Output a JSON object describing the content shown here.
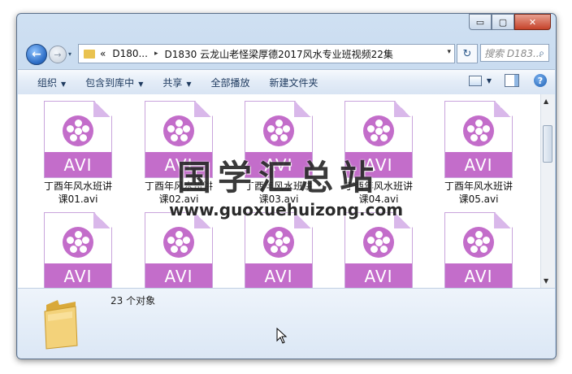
{
  "window": {
    "caption_buttons": {
      "minimize": "▭",
      "maximize": "▢",
      "close": "✕"
    }
  },
  "nav": {
    "history_chevron": "▾",
    "breadcrumb": [
      "«",
      "D180...",
      "D1830 云龙山老怪梁厚德2017风水专业班视频22集"
    ],
    "breadcrumb_separator": "▸",
    "address_dropdown": "▾",
    "refresh_glyph": "↻",
    "search_placeholder": "搜索 D183...",
    "search_glyph": "⌕"
  },
  "toolbar": {
    "organize": "组织",
    "include_library": "包含到库中",
    "share": "共享",
    "play_all": "全部播放",
    "new_folder": "新建文件夹",
    "dropdown_glyph": "▼",
    "help": "?"
  },
  "files": [
    {
      "badge": "AVI",
      "name_line1": "丁酉年风水班讲",
      "name_line2": "课01.avi"
    },
    {
      "badge": "AVI",
      "name_line1": "丁酉年风水班讲",
      "name_line2": "课02.avi"
    },
    {
      "badge": "AVI",
      "name_line1": "丁酉年风水班讲",
      "name_line2": "课03.avi"
    },
    {
      "badge": "AVI",
      "name_line1": "丁酉年风水班讲",
      "name_line2": "课04.avi"
    },
    {
      "badge": "AVI",
      "name_line1": "丁酉年风水班讲",
      "name_line2": "课05.avi"
    },
    {
      "badge": "AVI"
    },
    {
      "badge": "AVI"
    },
    {
      "badge": "AVI"
    },
    {
      "badge": "AVI"
    },
    {
      "badge": "AVI"
    }
  ],
  "details": {
    "count_text": "23 个对象"
  },
  "watermark": {
    "title": "国学汇总站",
    "url": "www.guoxuehuizong.com"
  },
  "colors": {
    "avi_purple": "#c36dca",
    "frame_blue": "#b9d0ea"
  },
  "icons": [
    "back-arrow-icon",
    "forward-arrow-icon",
    "folder-icon",
    "refresh-icon",
    "search-icon",
    "view-icon",
    "preview-pane-icon",
    "help-icon",
    "video-reel-icon"
  ]
}
